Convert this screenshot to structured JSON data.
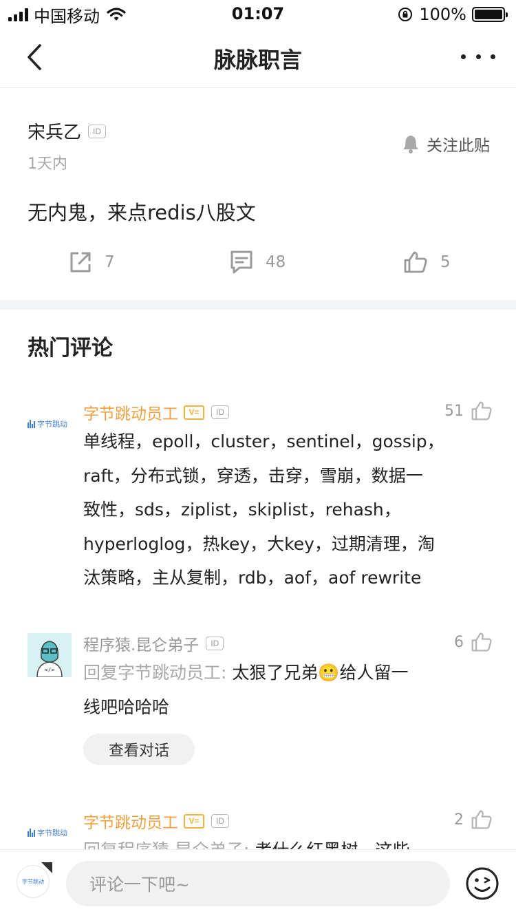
{
  "status_bar": {
    "carrier": "中国移动",
    "time": "01:07",
    "battery": "100%",
    "battery_level": 1.0
  },
  "nav": {
    "title": "脉脉职言"
  },
  "post": {
    "author": "宋兵乙",
    "id_badge": "ID",
    "time": "1天内",
    "follow_label": "关注此贴",
    "content": "无内鬼，来点redis八股文",
    "share_count": "7",
    "comment_count": "48",
    "like_count": "5"
  },
  "section_title": "热门评论",
  "comments": [
    {
      "author": "字节跳动员工",
      "verified_badge": "V=",
      "id_badge": "ID",
      "likes": "51",
      "avatar_logo": "字节跳动",
      "lines": [
        "单线程，epoll，cluster，sentinel，gossip，",
        "raft，分布式锁，穿透，击穿，雪崩，数据一",
        "致性，sds，ziplist，skiplist，rehash，",
        "hyperloglog，热key，大key，过期清理，淘",
        "汰策略，主从复制，rdb，aof，aof rewrite"
      ]
    },
    {
      "author": "程序猿.昆仑弟子",
      "id_badge": "ID",
      "likes": "6",
      "reply_prefix": "回复字节跳动员工: ",
      "line1": "太狠了兄弟😬给人留一",
      "line2": "线吧哈哈哈",
      "view_conversation": "查看对话"
    },
    {
      "author": "字节跳动员工",
      "verified_badge": "V=",
      "id_badge": "ID",
      "likes": "2",
      "avatar_logo": "字节跳动",
      "reply_prefix": "回复程序猿.昆仑弟子: ",
      "partial": "考什么红黑树，这些"
    }
  ],
  "bottom_bar": {
    "avatar_text": "字节跳动",
    "input_placeholder": "评论一下吧~"
  },
  "colors": {
    "accent_orange": "#f0a040",
    "muted": "#999999",
    "logo_blue": "#3a7bd5"
  }
}
